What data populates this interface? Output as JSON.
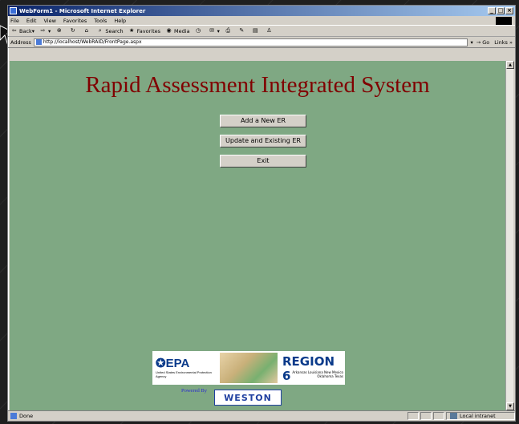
{
  "window": {
    "title": "WebForm1 - Microsoft Internet Explorer"
  },
  "menu": {
    "items": [
      "File",
      "Edit",
      "View",
      "Favorites",
      "Tools",
      "Help"
    ]
  },
  "toolbar": {
    "back": "Back",
    "search": "Search",
    "favorites": "Favorites",
    "media": "Media"
  },
  "address": {
    "label": "Address",
    "url": "http://localhost/WebRAID/FrontPage.aspx",
    "go": "Go",
    "links": "Links"
  },
  "page": {
    "title": "Rapid Assessment Integrated System",
    "buttons": [
      "Add a New ER",
      "Update and Existing ER",
      "Exit"
    ],
    "epa_name": "EPA",
    "epa_sub": "United States Environmental Protection Agency",
    "region": "REGION 6",
    "region_sub": "Arkansas Louisiana New Mexico Oklahoma Texas",
    "powered_by": "Powered By",
    "weston": "WESTON"
  },
  "status": {
    "text": "Done",
    "zone": "Local intranet"
  }
}
